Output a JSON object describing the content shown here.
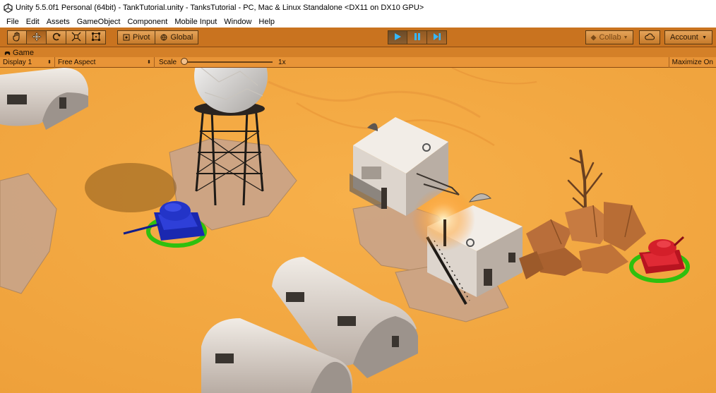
{
  "window": {
    "title": "Unity 5.5.0f1 Personal (64bit) - TankTutorial.unity - TanksTutorial - PC, Mac & Linux Standalone <DX11 on DX10 GPU>"
  },
  "menu": {
    "items": [
      "File",
      "Edit",
      "Assets",
      "GameObject",
      "Component",
      "Mobile Input",
      "Window",
      "Help"
    ]
  },
  "toolbar": {
    "tools": [
      {
        "name": "hand-tool",
        "icon": "hand-icon"
      },
      {
        "name": "move-tool",
        "icon": "move-icon"
      },
      {
        "name": "rotate-tool",
        "icon": "rotate-icon"
      },
      {
        "name": "scale-tool",
        "icon": "scale-icon"
      },
      {
        "name": "rect-tool",
        "icon": "rect-icon"
      }
    ],
    "active_tool": "move-tool",
    "pivot_label": "Pivot",
    "global_label": "Global",
    "collab_label": "Collab",
    "account_label": "Account",
    "play_state": "playing"
  },
  "game_view": {
    "tab_label": "Game",
    "display_label": "Display 1",
    "aspect_label": "Free Aspect",
    "scale_label": "Scale",
    "scale_value": "1x",
    "maximize_label": "Maximize On"
  },
  "colors": {
    "accent": "#c9731f",
    "sand": "#f4aa3f",
    "blue_tank": "#1f2fc8",
    "red_tank": "#d41f2a",
    "ring": "#2fc00e"
  }
}
